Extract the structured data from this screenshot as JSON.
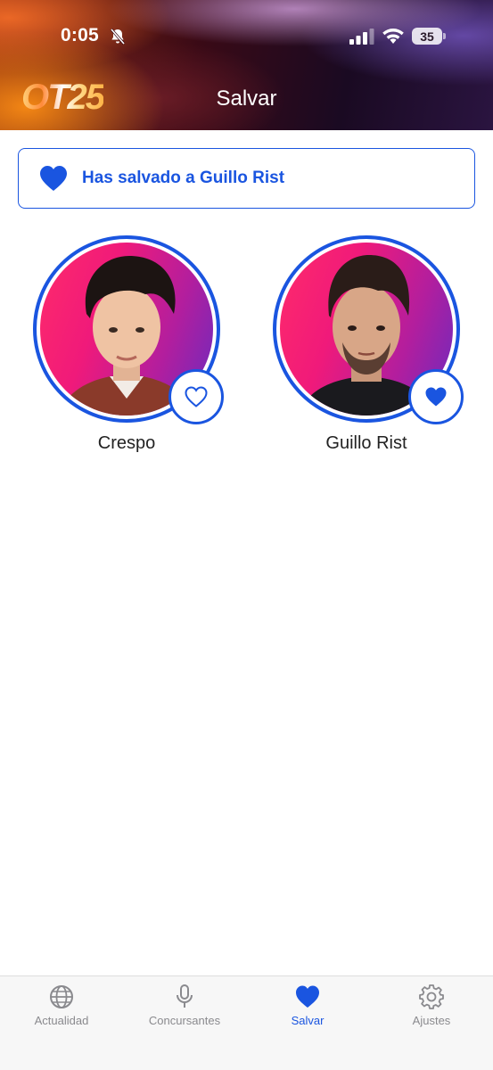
{
  "status_bar": {
    "time": "0:05",
    "battery": "35"
  },
  "header": {
    "logo": "OT25",
    "title": "Salvar"
  },
  "banner": {
    "text": "Has salvado a Guillo Rist"
  },
  "contestants": [
    {
      "name": "Crespo",
      "saved": false
    },
    {
      "name": "Guillo Rist",
      "saved": true
    }
  ],
  "tabbar": {
    "tabs": [
      {
        "label": "Actualidad",
        "icon": "globe-icon",
        "active": false
      },
      {
        "label": "Concursantes",
        "icon": "microphone-icon",
        "active": false
      },
      {
        "label": "Salvar",
        "icon": "heart-icon",
        "active": true
      },
      {
        "label": "Ajustes",
        "icon": "gear-icon",
        "active": false
      }
    ]
  },
  "colors": {
    "accent": "#1a55e0",
    "inactive": "#8a8a8e"
  }
}
